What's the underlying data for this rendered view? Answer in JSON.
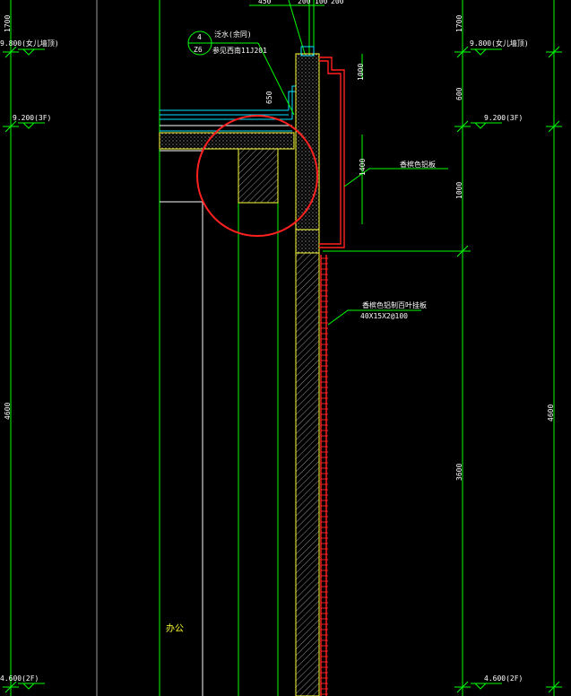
{
  "labels": {
    "top_dims": [
      "450",
      "200",
      "100",
      "200"
    ],
    "left_dim_top": "1700",
    "left_elev_top": "9.800(女儿墙顶)",
    "left_elev_3f": "9.200(3F)",
    "left_dim_mid": "4600",
    "left_elev_2f": "4.600(2F)",
    "right_dim_top": "1700",
    "right_elev_top": "9.800(女儿墙顶)",
    "right_dim_600": "600",
    "right_elev_3f": "9.200(3F)",
    "right_dim_1000": "1000",
    "right_dim_4600": "4600",
    "right_dim_3600": "3600",
    "right_elev_2f": "4.600(2F)",
    "detail_num": "4",
    "detail_sheet": "Z6",
    "note_flashing": "泛水(余同)",
    "note_ref": "参见西南11J201",
    "dim_650": "650",
    "dim_1000_top": "1000",
    "dim_1400": "1400",
    "note_aluminum_panel": "香槟色铝板",
    "note_louver": "香槟色铝制百叶挂板",
    "note_louver_spec": "40X15X2@100",
    "room_name": "办公"
  },
  "colors": {
    "green": "#00ff00",
    "yellow": "#ffff00",
    "red": "#ff2020",
    "white": "#ffffff",
    "cyan": "#00e5ff",
    "grey": "#9a9a9a"
  }
}
